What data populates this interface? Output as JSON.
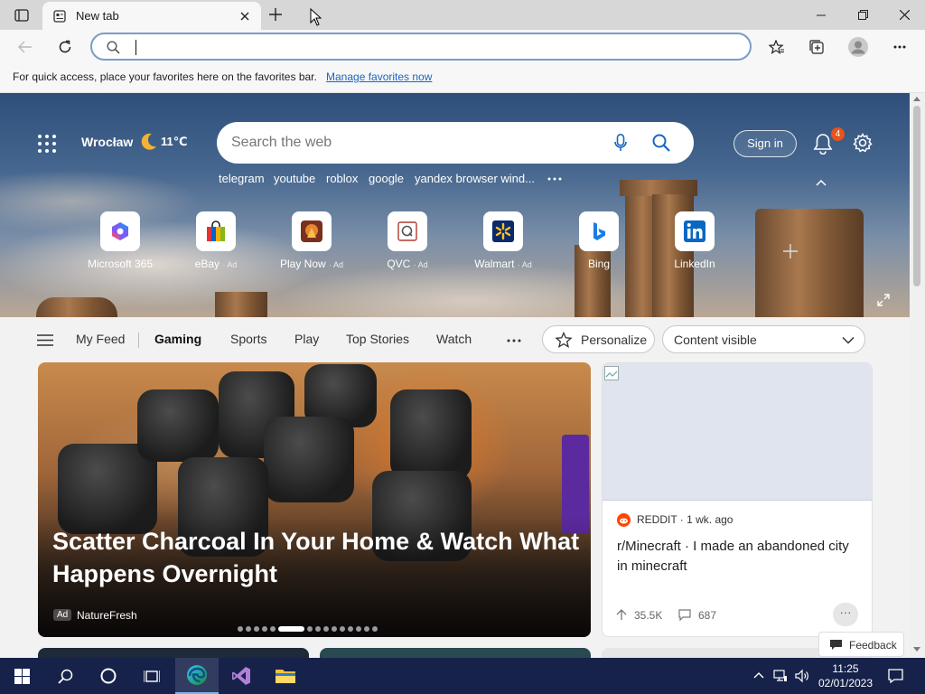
{
  "browser": {
    "tab_title": "New tab",
    "address_value": "",
    "favorites_bar": {
      "message": "For quick access, place your favorites here on the favorites bar.",
      "link": "Manage favorites now"
    }
  },
  "hero": {
    "city": "Wrocław",
    "temperature": "11℃",
    "search_placeholder": "Search the web",
    "trending": [
      "telegram",
      "youtube",
      "roblox",
      "google",
      "yandex browser wind..."
    ],
    "sign_in": "Sign in",
    "notification_count": "4",
    "quick_links": [
      {
        "name": "Microsoft 365",
        "ad": ""
      },
      {
        "name": "eBay",
        "ad": "· Ad"
      },
      {
        "name": "Play Now",
        "ad": "· Ad"
      },
      {
        "name": "QVC",
        "ad": "· Ad"
      },
      {
        "name": "Walmart",
        "ad": "· Ad"
      },
      {
        "name": "Bing",
        "ad": ""
      },
      {
        "name": "LinkedIn",
        "ad": ""
      }
    ]
  },
  "nav": {
    "items": [
      "My Feed",
      "Gaming",
      "Sports",
      "Play",
      "Top Stories",
      "Watch"
    ],
    "active": "Gaming",
    "personalize": "Personalize",
    "visibility": "Content visible"
  },
  "feed": {
    "main_card": {
      "headline": "Scatter Charcoal In Your Home & Watch What Happens Overnight",
      "ad_label": "Ad",
      "source": "NatureFresh"
    },
    "side_card": {
      "source": "REDDIT · 1 wk. ago",
      "title": "r/Minecraft · I made an abandoned city in minecraft",
      "likes": "35.5K",
      "comments": "687"
    },
    "feedback": "Feedback"
  },
  "taskbar": {
    "time": "11:25",
    "date": "02/01/2023"
  },
  "colors": {
    "accent": "#1a65c1",
    "taskbar": "#16224a",
    "notification_badge": "#e8541c",
    "reddit": "#ff4500"
  }
}
